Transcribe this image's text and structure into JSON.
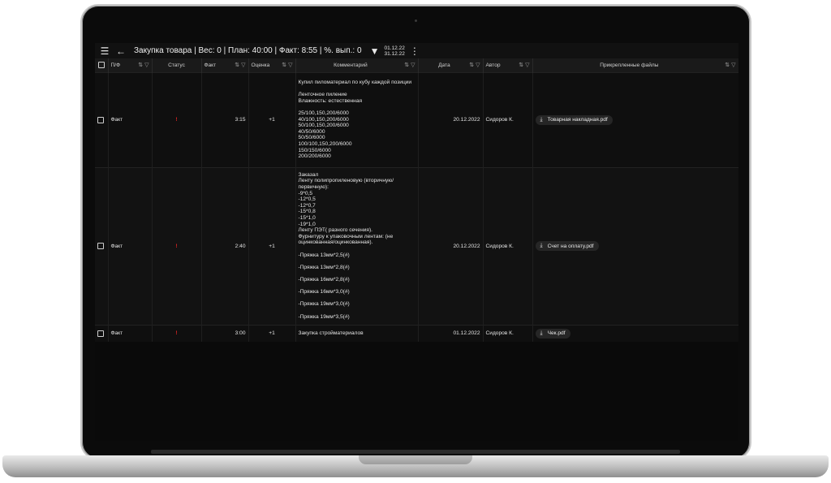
{
  "toolbar": {
    "menu_icon": "hamburger-menu-icon",
    "back_icon": "arrow-left-icon",
    "title": "Закупка товара | Вес: 0 | План: 40:00 | Факт: 8:55 | %. вып.: 0",
    "filter_icon": "filter-icon",
    "date_from": "01.12.22",
    "date_to": "31.12.22",
    "more_icon": "more-vert-icon"
  },
  "columns": {
    "pf": "П/Ф",
    "status": "Статус",
    "fact": "Факт",
    "rating": "Оценка",
    "comment": "Комментарий",
    "date": "Дата",
    "author": "Автор",
    "files": "Прикрепленные файлы"
  },
  "rows": [
    {
      "pf": "Факт",
      "status": "!",
      "fact": "3:15",
      "rating": "+1",
      "comment": "Купил пиломатериал по кубу каждой позиции\n\nЛенточное пиление\nВлажность: естественная\n\n25/100,150,200/6000\n40/100,150,200/6000\n50/100,150,200/6000\n40/50/6000\n50/50/6000\n100/100,150,200/6000\n150/150/6000\n200/200/6000",
      "date": "20.12.2022",
      "author": "Сидоров К.",
      "file": "Товарная накладная.pdf"
    },
    {
      "pf": "Факт",
      "status": "!",
      "fact": "2:40",
      "rating": "+1",
      "comment": "Заказал\nЛенту полипропиленовую (вторичную/первичную):\n-9*0,5\n-12*0,5\n-12*0,7\n-15*0,8\n-15*1,0\n-19*1,0\nЛенту ПЭТ( разного сечения).\nФурнитуру к упаковочным лентам: (не оцинкованная/оцинкованная).\n\n-Пряжка 13мм*2,5(#)\n\n-Пряжка 13мм*2,8(#)\n\n-Пряжка 16мм*2,8(#)\n\n-Пряжка 16мм*3,0(#)\n\n-Пряжка 19мм*3,0(#)\n\n-Пряжка 19мм*3,5(#)",
      "date": "20.12.2022",
      "author": "Сидоров К.",
      "file": "Счет на оплату.pdf"
    },
    {
      "pf": "Факт",
      "status": "!",
      "fact": "3:00",
      "rating": "+1",
      "comment": "Закупка стройматериалов",
      "date": "01.12.2022",
      "author": "Сидоров К.",
      "file": "Чек.pdf"
    }
  ],
  "icons": {
    "sort": "sort-icon",
    "filter": "filter-icon",
    "checkbox": "checkbox-icon",
    "download": "download-icon"
  },
  "colors": {
    "background": "#0a0a0a",
    "header": "#1a1a1a",
    "status_alert": "#e02424"
  }
}
